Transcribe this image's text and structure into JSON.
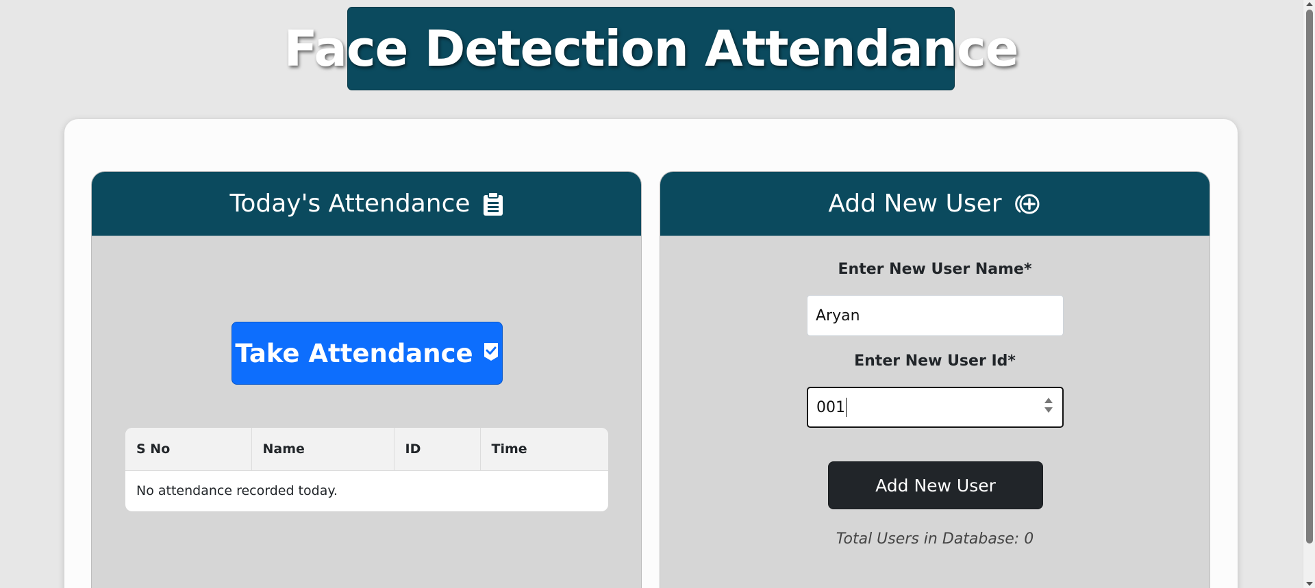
{
  "header": {
    "title": "Face Detection Attendance"
  },
  "attendance_panel": {
    "title": "Today's Attendance",
    "icon": "clipboard-icon",
    "take_button_label": "Take Attendance",
    "take_button_icon": "check-badge-icon",
    "table": {
      "columns": [
        "S No",
        "Name",
        "ID",
        "Time"
      ],
      "empty_message": "No attendance recorded today."
    }
  },
  "add_user_panel": {
    "title": "Add New User",
    "icon": "plus-circle-icon",
    "name_label": "Enter New User Name*",
    "name_value": "Aryan",
    "id_label": "Enter New User Id*",
    "id_value": "001",
    "submit_label": "Add New User",
    "total_users_text": "Total Users in Database: 0"
  },
  "colors": {
    "header_bg": "#0b4a5e",
    "primary_button": "#0d6efd",
    "dark_button": "#212529",
    "panel_bg": "#d6d6d6"
  }
}
